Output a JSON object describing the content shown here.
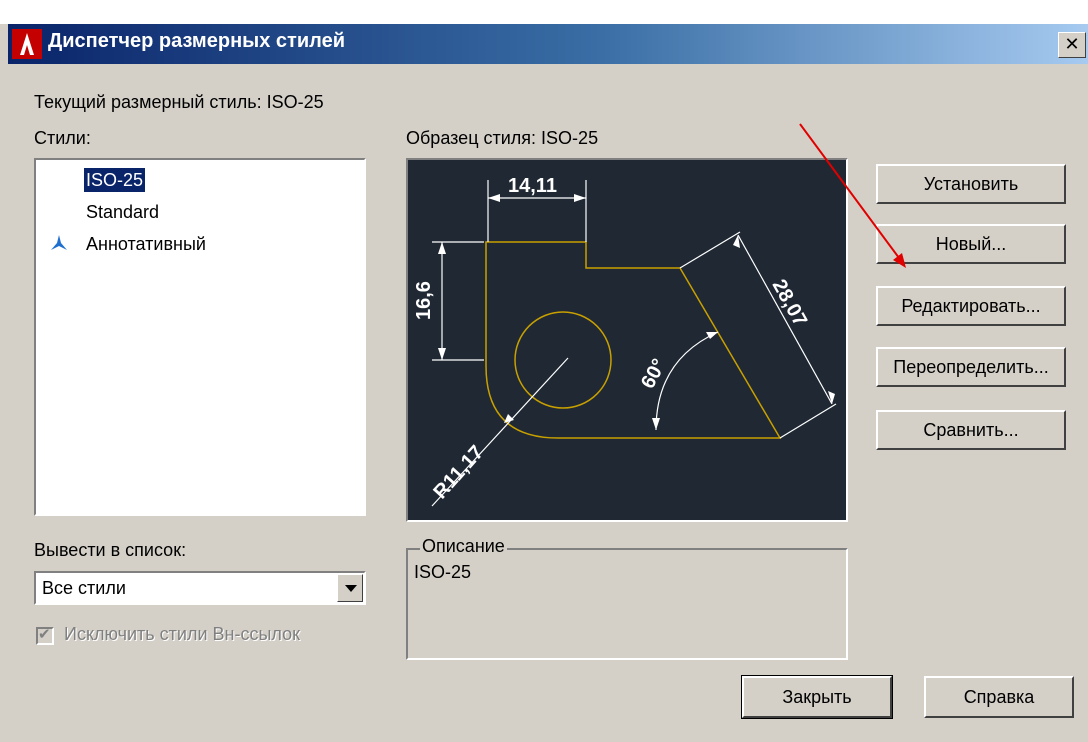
{
  "window": {
    "title": "Диспетчер размерных стилей",
    "close_label": "✕"
  },
  "current_style": "Текущий размерный стиль: ISO-25",
  "styles": {
    "label": "Стили:",
    "items": [
      {
        "label": "ISO-25",
        "selected": true
      },
      {
        "label": "Standard",
        "selected": false
      },
      {
        "label": "Аннотативный",
        "selected": false,
        "icon": "annotative-icon"
      }
    ]
  },
  "preview": {
    "label": "Образец стиля: ISO-25",
    "dimensions": {
      "top": "14,11",
      "left": "16,6",
      "right": "28,07",
      "angle": "60°",
      "radius": "R11,17"
    }
  },
  "buttons": {
    "set_current": "Установить",
    "new": "Новый...",
    "modify": "Редактировать...",
    "override": "Переопределить...",
    "compare": "Сравнить...",
    "close": "Закрыть",
    "help": "Справка"
  },
  "list_filter": {
    "label": "Вывести в список:",
    "value": "Все стили"
  },
  "exclude_xref": {
    "label": "Исключить стили Вн-ссылок",
    "checked": true,
    "disabled": true
  },
  "description": {
    "legend": "Описание",
    "text": "ISO-25"
  },
  "colors": {
    "preview_bg": "#1f2833",
    "geometry": "#c8a000",
    "selection": "#0a246a",
    "annotation_arrow": "#e00000"
  }
}
